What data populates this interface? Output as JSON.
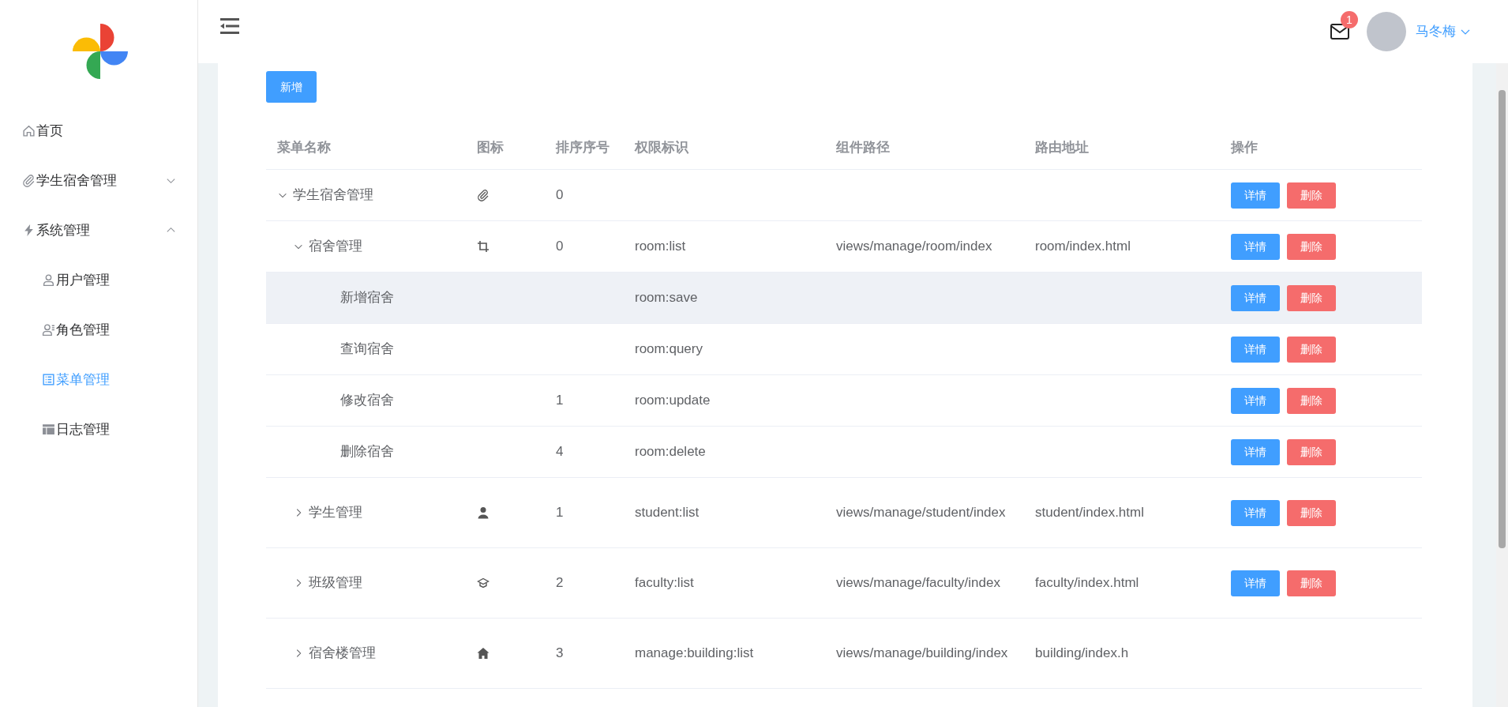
{
  "sidebar": {
    "items": [
      {
        "label": "首页",
        "kind": "home",
        "selected": false
      },
      {
        "label": "学生宿舍管理",
        "kind": "paperclip",
        "expanded": false,
        "selected": false
      },
      {
        "label": "系统管理",
        "kind": "bolt",
        "expanded": true,
        "selected": false,
        "children": [
          {
            "label": "用户管理",
            "kind": "user",
            "selected": false
          },
          {
            "label": "角色管理",
            "kind": "userlist",
            "selected": false
          },
          {
            "label": "菜单管理",
            "kind": "list",
            "selected": true
          },
          {
            "label": "日志管理",
            "kind": "table",
            "selected": false
          }
        ]
      }
    ]
  },
  "header": {
    "notification_count": "1",
    "user_name": "马冬梅"
  },
  "toolbar": {
    "add_button": "新增"
  },
  "table": {
    "columns": [
      "菜单名称",
      "图标",
      "排序序号",
      "权限标识",
      "组件路径",
      "路由地址",
      "操作"
    ],
    "rows": [
      {
        "name": "学生宿舍管理",
        "kind": "paperclip",
        "sort": "0",
        "expanded": true,
        "highlighted": false,
        "actions": [
          "详情",
          "删除"
        ],
        "children": [
          {
            "name": "宿舍管理",
            "kind": "crop",
            "sort": "0",
            "perm": "room:list",
            "path": "views/manage/room/index",
            "route": "room/index.html",
            "expanded": true,
            "highlighted": false,
            "actions": [
              "详情",
              "删除"
            ],
            "children": [
              {
                "name": "新增宿舍",
                "perm": "room:save",
                "highlighted": true,
                "actions": [
                  "详情",
                  "删除"
                ]
              },
              {
                "name": "查询宿舍",
                "perm": "room:query",
                "highlighted": false,
                "actions": [
                  "详情",
                  "删除"
                ]
              },
              {
                "name": "修改宿舍",
                "sort": "1",
                "perm": "room:update",
                "highlighted": false,
                "actions": [
                  "详情",
                  "删除"
                ]
              },
              {
                "name": "删除宿舍",
                "sort": "4",
                "perm": "room:delete",
                "highlighted": false,
                "actions": [
                  "详情",
                  "删除"
                ]
              }
            ]
          },
          {
            "name": "学生管理",
            "kind": "person",
            "sort": "1",
            "perm": "student:list",
            "path": "views/manage/student/index",
            "route": "student/index.html",
            "expanded": false,
            "highlighted": false,
            "actions": [
              "详情",
              "删除"
            ]
          },
          {
            "name": "班级管理",
            "kind": "graduation",
            "sort": "2",
            "perm": "faculty:list",
            "path": "views/manage/faculty/index",
            "route": "faculty/index.html",
            "expanded": false,
            "highlighted": false,
            "actions": [
              "详情",
              "删除"
            ]
          },
          {
            "name": "宿舍楼管理",
            "kind": "house",
            "sort": "3",
            "perm": "manage:building:list",
            "path": "views/manage/building/index",
            "route": "building/index.h",
            "expanded": false,
            "highlighted": false
          }
        ]
      }
    ]
  }
}
